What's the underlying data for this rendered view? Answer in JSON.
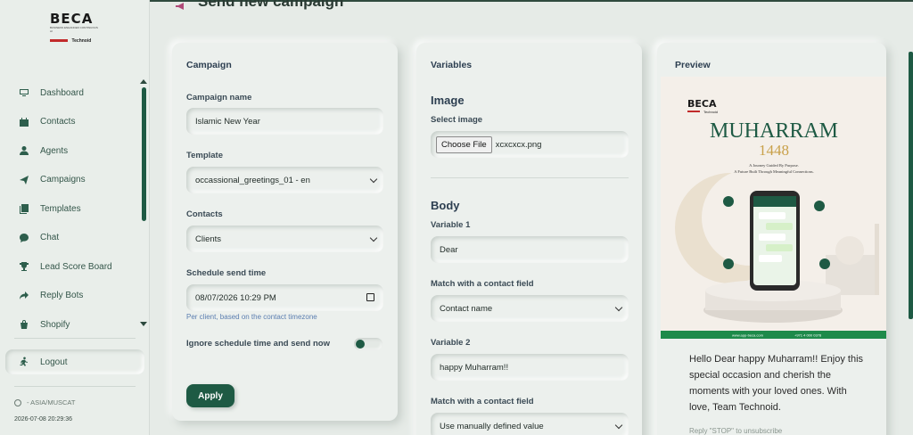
{
  "sidebar": {
    "logo": {
      "name": "BECA",
      "tagline": "BUSINESS ENHANCED CONTINUOUS AI",
      "brand": "Technoid"
    },
    "items": [
      {
        "label": "Dashboard",
        "icon": "monitor-icon"
      },
      {
        "label": "Contacts",
        "icon": "contacts-icon"
      },
      {
        "label": "Agents",
        "icon": "user-icon"
      },
      {
        "label": "Campaigns",
        "icon": "send-icon"
      },
      {
        "label": "Templates",
        "icon": "templates-icon"
      },
      {
        "label": "Chat",
        "icon": "chat-icon"
      },
      {
        "label": "Lead Score Board",
        "icon": "trophy-icon"
      },
      {
        "label": "Reply Bots",
        "icon": "reply-icon"
      },
      {
        "label": "Shopify",
        "icon": "shopping-bag-icon"
      }
    ],
    "logout_label": "Logout",
    "timezone": "- ASIA/MUSCAT",
    "datetime": "2026-07-08 20:29:36"
  },
  "page": {
    "title": "Send new campaign"
  },
  "campaign": {
    "title": "Campaign",
    "name_label": "Campaign name",
    "name_value": "Islamic New Year",
    "template_label": "Template",
    "template_value": "occassional_greetings_01 - en",
    "contacts_label": "Contacts",
    "contacts_value": "Clients",
    "schedule_label": "Schedule send time",
    "schedule_value": "08/07/2026 10:29 PM",
    "schedule_hint": "Per client, based on the contact timezone",
    "ignore_label": "Ignore schedule time and send now",
    "ignore_on": true,
    "apply_label": "Apply"
  },
  "variables": {
    "title": "Variables",
    "image_heading": "Image",
    "select_image_label": "Select image",
    "choose_file_label": "Choose File",
    "file_name": "xcxcxcx.png",
    "body_heading": "Body",
    "var1_label": "Variable 1",
    "var1_value": "Dear",
    "match1_label": "Match with a contact field",
    "match1_value": "Contact name",
    "var2_label": "Variable 2",
    "var2_value": "happy Muharram!!",
    "match2_label": "Match with a contact field",
    "match2_value": "Use manually defined value"
  },
  "preview": {
    "title": "Preview",
    "image": {
      "brand": "BECA",
      "brand_sub": "Technoid",
      "heading": "MUHARRAM",
      "year": "1448",
      "line1": "A Journey Guided By Purpose.",
      "line2": "A Future Built Through Meaningful Connections.",
      "footer_url": "www.app-beca.com",
      "footer_phone": "+971 4 000 0378"
    },
    "message": "Hello Dear happy Muharram!! Enjoy this special occasion and cherish the moments with your loved ones. With love, Team Technoid.",
    "unsubscribe": "Reply \"STOP\" to unsubscribe"
  },
  "colors": {
    "accent": "#1e5a44",
    "background": "#e6ebe7",
    "hint": "#5b7eb0"
  }
}
